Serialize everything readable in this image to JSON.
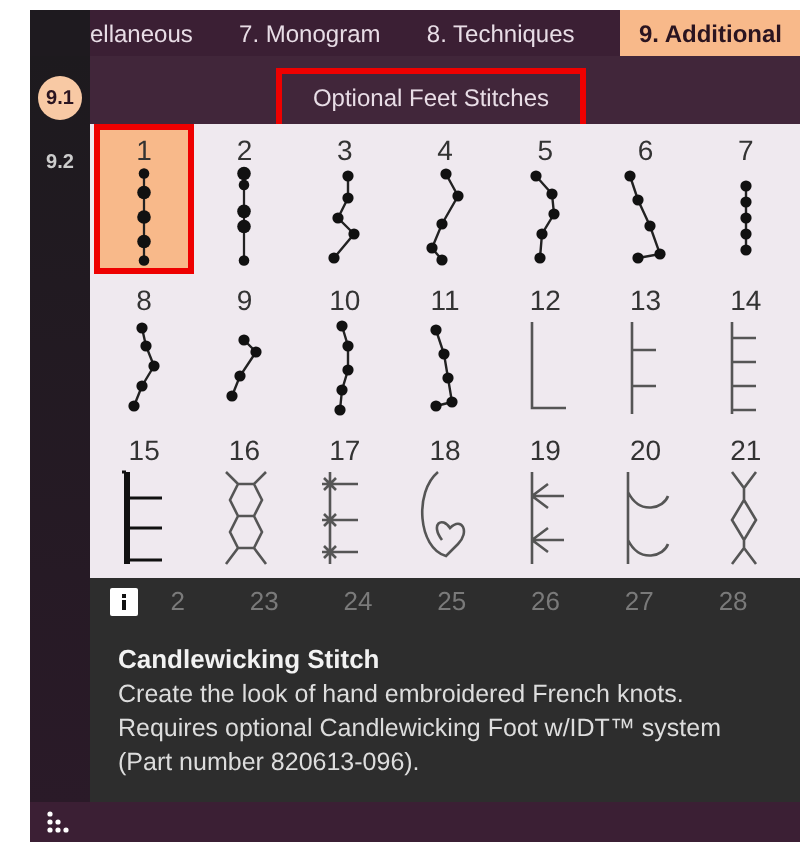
{
  "tabs": [
    {
      "label": "ellaneous",
      "selected": false
    },
    {
      "label": "7. Monogram",
      "selected": false
    },
    {
      "label": "8. Techniques",
      "selected": false
    },
    {
      "label": "9. Additional",
      "selected": true
    }
  ],
  "sidebar": {
    "items": [
      {
        "label": "9.1",
        "selected": true
      },
      {
        "label": "9.2",
        "selected": false
      }
    ]
  },
  "subheader": {
    "title": "Optional Feet Stitches",
    "highlighted": true
  },
  "stitches": [
    {
      "number": "1",
      "selected": true,
      "highlighted": true
    },
    {
      "number": "2",
      "selected": false,
      "highlighted": false
    },
    {
      "number": "3",
      "selected": false,
      "highlighted": false
    },
    {
      "number": "4",
      "selected": false,
      "highlighted": false
    },
    {
      "number": "5",
      "selected": false,
      "highlighted": false
    },
    {
      "number": "6",
      "selected": false,
      "highlighted": false
    },
    {
      "number": "7",
      "selected": false,
      "highlighted": false
    },
    {
      "number": "8",
      "selected": false,
      "highlighted": false
    },
    {
      "number": "9",
      "selected": false,
      "highlighted": false
    },
    {
      "number": "10",
      "selected": false,
      "highlighted": false
    },
    {
      "number": "11",
      "selected": false,
      "highlighted": false
    },
    {
      "number": "12",
      "selected": false,
      "highlighted": false
    },
    {
      "number": "13",
      "selected": false,
      "highlighted": false
    },
    {
      "number": "14",
      "selected": false,
      "highlighted": false
    },
    {
      "number": "15",
      "selected": false,
      "highlighted": false
    },
    {
      "number": "16",
      "selected": false,
      "highlighted": false
    },
    {
      "number": "17",
      "selected": false,
      "highlighted": false
    },
    {
      "number": "18",
      "selected": false,
      "highlighted": false
    },
    {
      "number": "19",
      "selected": false,
      "highlighted": false
    },
    {
      "number": "20",
      "selected": false,
      "highlighted": false
    },
    {
      "number": "21",
      "selected": false,
      "highlighted": false
    }
  ],
  "info_panel": {
    "covered_numbers": [
      "2",
      "23",
      "24",
      "25",
      "26",
      "27",
      "28"
    ],
    "title": "Candlewicking Stitch",
    "description": "Create the look of hand embroidered French knots. Requires optional Candlewicking Foot w/IDT™ system (Part number 820613-096)."
  }
}
